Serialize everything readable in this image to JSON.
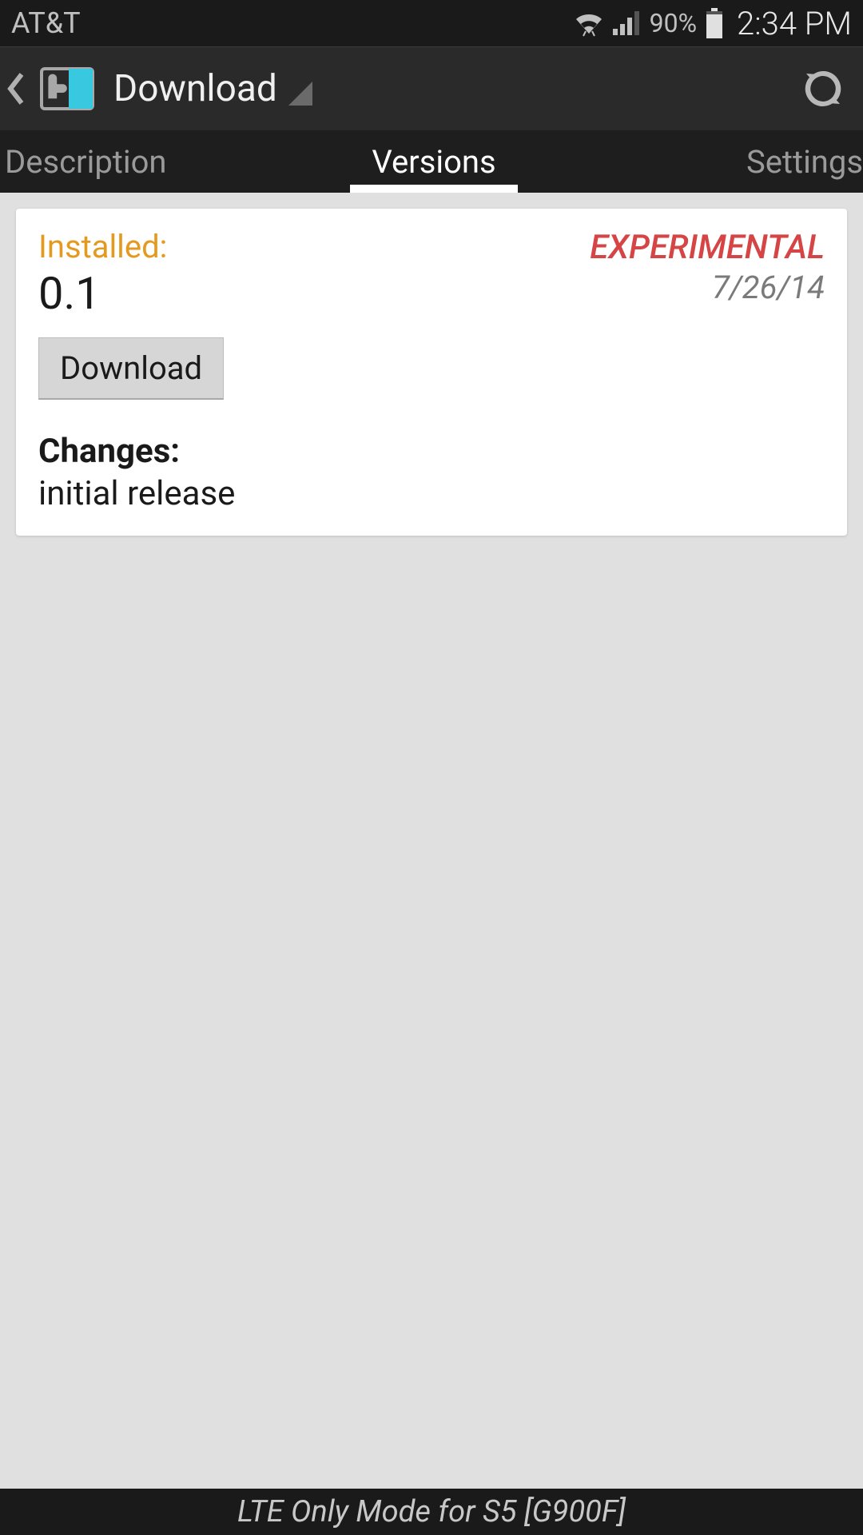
{
  "statusBar": {
    "carrier": "AT&T",
    "batteryPercent": "90%",
    "time": "2:34 PM"
  },
  "actionBar": {
    "title": "Download"
  },
  "tabs": [
    {
      "label": "Description",
      "active": false
    },
    {
      "label": "Versions",
      "active": true
    },
    {
      "label": "Settings",
      "active": false
    }
  ],
  "versionCard": {
    "installedLabel": "Installed:",
    "version": "0.1",
    "status": "EXPERIMENTAL",
    "date": "7/26/14",
    "downloadButton": "Download",
    "changesLabel": "Changes:",
    "changesText": "initial release"
  },
  "bottomBar": {
    "text": "LTE Only Mode for S5 [G900F]"
  },
  "colors": {
    "accentOrange": "#e39a1f",
    "experimentalRed": "#d64545",
    "darkBg": "#1e1e1e"
  }
}
